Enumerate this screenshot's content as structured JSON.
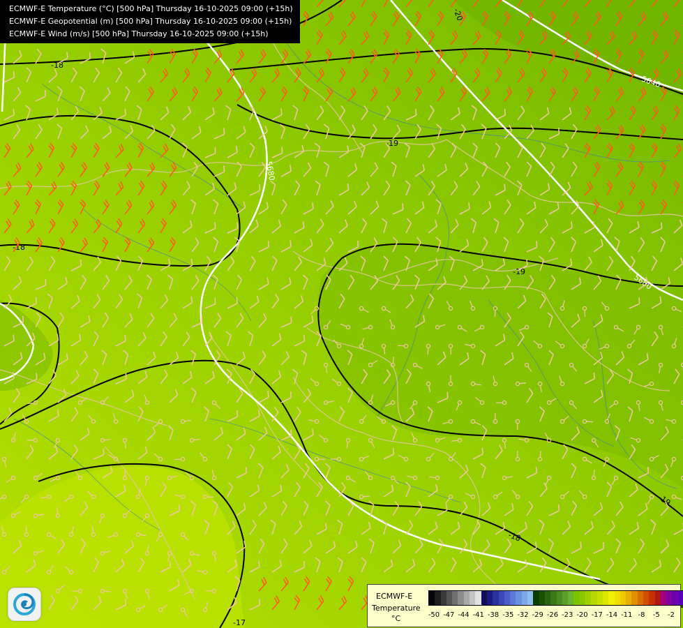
{
  "titles": [
    "ECMWF-E Temperature (°C) [500 hPa] Thursday 16-10-2025 09:00 (+15h)",
    "ECMWF-E Geopotential (m) [500 hPa] Thursday 16-10-2025 09:00 (+15h)",
    "ECMWF-E Wind (m/s) [500 hPa] Thursday 16-10-2025 09:00 (+15h)"
  ],
  "temperature_labels": [
    "-20",
    "-18",
    "-19",
    "-18",
    "-19",
    "-19",
    "-18",
    "-17"
  ],
  "geopotential_labels": [
    "5640",
    "5680",
    "5680"
  ],
  "legend": {
    "model": "ECMWF-E",
    "variable": "Temperature",
    "unit": "°C",
    "tick_labels": [
      "-50",
      "-47",
      "-44",
      "-41",
      "-38",
      "-35",
      "-32",
      "-29",
      "-26",
      "-23",
      "-20",
      "-17",
      "-14",
      "-11",
      "-8",
      "-5",
      "-2"
    ],
    "colors": [
      "#050505",
      "#1e1e1e",
      "#3a3a3a",
      "#555555",
      "#707070",
      "#8c8c8c",
      "#a8a8a8",
      "#c4c4c4",
      "#e2e2e2",
      "#10105a",
      "#1c1c80",
      "#2a30a0",
      "#3a48b8",
      "#4a60c8",
      "#5a78d8",
      "#6a90e0",
      "#7aa8e8",
      "#8cc0f0",
      "#0b3c00",
      "#1a5000",
      "#2a6410",
      "#3a7818",
      "#4a8c20",
      "#5aa028",
      "#6ab430",
      "#7cc400",
      "#8cc800",
      "#a0d000",
      "#b4d800",
      "#c8e000",
      "#dce800",
      "#f0f000",
      "#f0e000",
      "#f0c800",
      "#e8b000",
      "#e09000",
      "#d87000",
      "#d05000",
      "#c83000",
      "#b01818",
      "#a00080",
      "#8000a0",
      "#6a00b0",
      "#5a00b8",
      "#4a0098"
    ]
  },
  "colors": {
    "temp_contour": "#000000",
    "geopotential_contour": "#ffffff",
    "wind_barb_strong": "#ff5a1e",
    "wind_barb_weak": "#f0c8a0",
    "borders": "#e8c89a",
    "rivers": "#3a7ab0"
  }
}
